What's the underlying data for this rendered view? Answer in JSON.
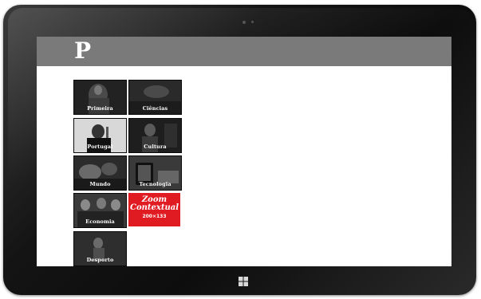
{
  "app": {
    "logo_text": "P"
  },
  "tiles": [
    {
      "label": "Primeira"
    },
    {
      "label": "Ciências"
    },
    {
      "label": "Portugal"
    },
    {
      "label": "Cultura"
    },
    {
      "label": "Mundo"
    },
    {
      "label": "Tecnologia"
    },
    {
      "label": "Economia"
    },
    {
      "label": "Desporto"
    }
  ],
  "ad": {
    "line1": "Zoom",
    "line2": "Contextual",
    "size": "200×133"
  },
  "colors": {
    "appbar": "#7a7a7a",
    "ad_red": "#e01b22",
    "bezel": "#141414"
  },
  "icons": {
    "start": "windows-logo-icon"
  }
}
